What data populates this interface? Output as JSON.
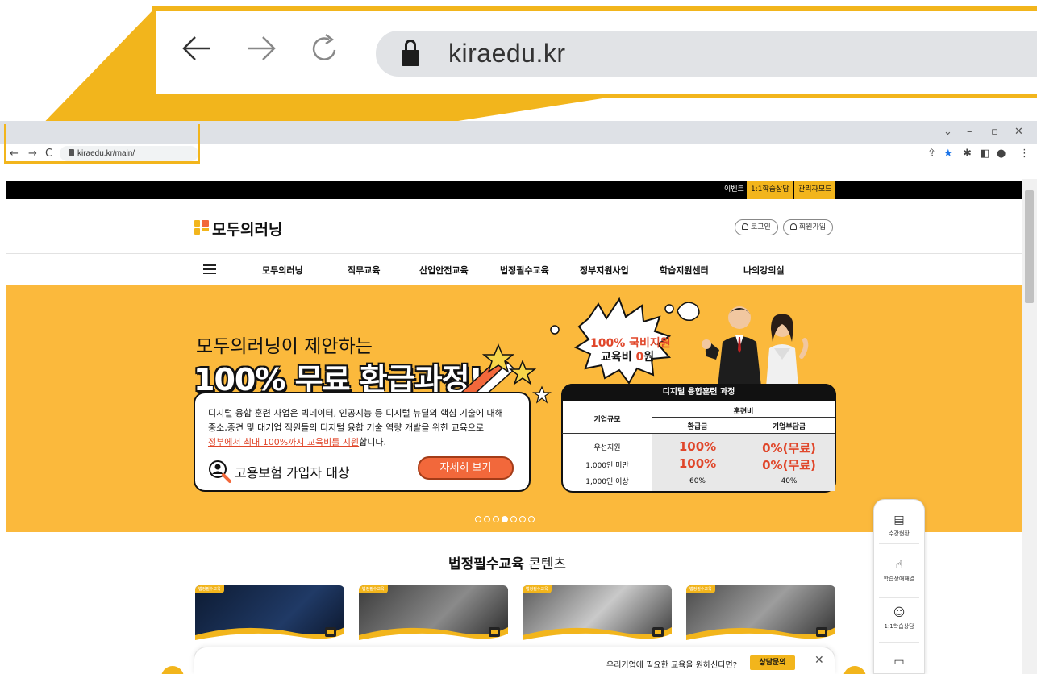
{
  "zoom_callout": {
    "back_icon": "arrow-left-icon",
    "forward_icon": "arrow-right-icon",
    "reload_icon": "reload-icon",
    "lock_icon": "lock-icon",
    "url": "kiraedu.kr"
  },
  "browser": {
    "url": "kiraedu.kr/main/",
    "controls": {
      "chevron": "⌄",
      "minimize": "–",
      "restore": "▫",
      "close": "✕"
    }
  },
  "top_bar": {
    "event": "이벤트",
    "consult": "1:1학습상담",
    "admin": "관리자모드"
  },
  "header": {
    "logo": "모두의러닝",
    "login": "로그인",
    "join": "회원가입"
  },
  "nav": {
    "items": [
      "모두의러닝",
      "직무교육",
      "산업안전교육",
      "법정필수교육",
      "정부지원사업",
      "학습지원센터",
      "나의강의실"
    ]
  },
  "hero": {
    "subtitle": "모두의러닝이 제안하는",
    "title": "100% 무료 환급과정!",
    "desc_line1": "디지털 융합 훈련 사업은 빅데이터, 인공지능 등 디지털 뉴딜의 핵심 기술에 대해",
    "desc_line2": "중소,중견 및 대기업 직원들의 디지털 융합 기술 역량 개발을 위한 교육으로",
    "desc_line3_red": "정부에서 최대 100%까지 교육비를 지원",
    "desc_line3_tail": "합니다.",
    "insurance": "고용보험 가입자 대상",
    "detail_button": "자세히 보기",
    "burst_line1": "100% 국비지원",
    "burst_line2_a": "교육비 ",
    "burst_line2_b": "0",
    "burst_line2_c": "원",
    "table": {
      "title": "디지털 융합훈련 과정",
      "col_company": "기업규모",
      "col_fee": "훈련비",
      "col_refund": "환급금",
      "col_burden": "기업부담금",
      "rows": [
        {
          "size": "우선지원",
          "refund": "100%",
          "burden": "0%(무료)"
        },
        {
          "size": "1,000인 미만",
          "refund": "100%",
          "burden": "0%(무료)"
        },
        {
          "size": "1,000인 이상",
          "refund": "60%",
          "burden": "40%"
        }
      ]
    },
    "slides_total": 7,
    "slides_active": 4
  },
  "section": {
    "title_bold": "법정필수교육",
    "title_rest": " 콘텐츠",
    "card_badge": "법정필수교육"
  },
  "side_panel": {
    "items": [
      {
        "icon": "lecture-status-icon",
        "label": "수강현황"
      },
      {
        "icon": "support-icon",
        "label": "학습장애해결"
      },
      {
        "icon": "chat-icon",
        "label": "1:1학습상담"
      },
      {
        "icon": "device-icon",
        "label": ""
      }
    ]
  },
  "consult_bar": {
    "text": "우리기업에 필요한 교육을 원하신다면?",
    "button": "상담문의",
    "close": "✕"
  },
  "colors": {
    "accent": "#f2b51c",
    "hero_bg": "#fbb93c",
    "red": "#e0462a",
    "cta": "#f2683b"
  }
}
